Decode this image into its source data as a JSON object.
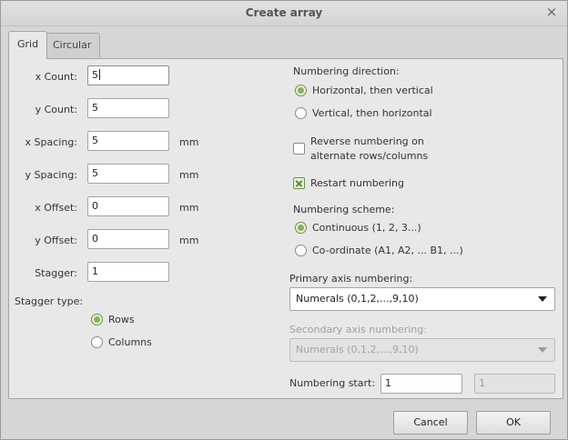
{
  "window": {
    "title": "Create array",
    "close_glyph": "×"
  },
  "tabs": [
    {
      "label": "Grid",
      "active": true
    },
    {
      "label": "Circular",
      "active": false
    }
  ],
  "grid": {
    "x_count": {
      "label": "x Count:",
      "value": "5"
    },
    "y_count": {
      "label": "y Count:",
      "value": "5"
    },
    "x_spacing": {
      "label": "x Spacing:",
      "value": "5",
      "unit": "mm"
    },
    "y_spacing": {
      "label": "y Spacing:",
      "value": "5",
      "unit": "mm"
    },
    "x_offset": {
      "label": "x Offset:",
      "value": "0",
      "unit": "mm"
    },
    "y_offset": {
      "label": "y Offset:",
      "value": "0",
      "unit": "mm"
    },
    "stagger": {
      "label": "Stagger:",
      "value": "1"
    },
    "stagger_type": {
      "label": "Stagger type:",
      "options": [
        {
          "label": "Rows",
          "selected": true
        },
        {
          "label": "Columns",
          "selected": false
        }
      ]
    }
  },
  "numbering": {
    "direction": {
      "label": "Numbering direction:",
      "options": [
        {
          "label": "Horizontal, then vertical",
          "selected": true
        },
        {
          "label": "Vertical, then horizontal",
          "selected": false
        }
      ]
    },
    "reverse": {
      "label_line1": "Reverse numbering on",
      "label_line2": "alternate rows/columns",
      "checked": false
    },
    "restart": {
      "label": "Restart numbering",
      "checked": true
    },
    "scheme": {
      "label": "Numbering scheme:",
      "options": [
        {
          "label": "Continuous (1, 2, 3...)",
          "selected": true
        },
        {
          "label": "Co-ordinate (A1, A2, ... B1, ...)",
          "selected": false
        }
      ]
    },
    "primary_axis": {
      "label": "Primary axis numbering:",
      "value": "Numerals (0,1,2,...,9,10)"
    },
    "secondary_axis": {
      "label": "Secondary axis numbering:",
      "value": "Numerals (0,1,2,...,9,10)",
      "enabled": false
    },
    "start": {
      "label": "Numbering start:",
      "primary_value": "1",
      "secondary_value": "1"
    }
  },
  "buttons": {
    "cancel": "Cancel",
    "ok": "OK"
  },
  "colors": {
    "accent_green": "#88b060",
    "background": "#d6d6d6",
    "panel": "#e8e8e8"
  }
}
